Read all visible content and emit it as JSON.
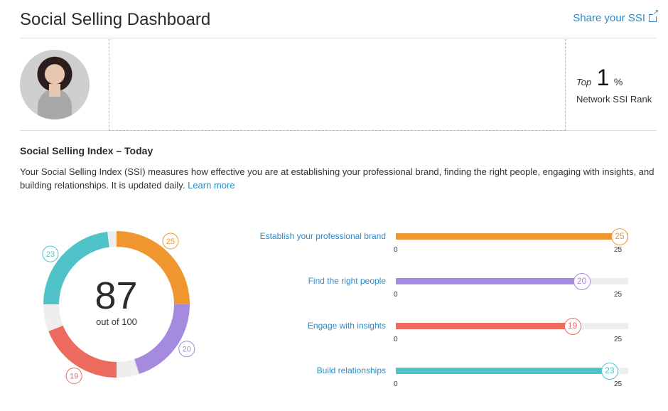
{
  "header": {
    "title": "Social Selling Dashboard",
    "share_label": "Share your SSI"
  },
  "profile": {
    "rank_top_label": "Top",
    "rank_value": "1",
    "rank_unit": "%",
    "rank_caption": "Network SSI Rank"
  },
  "ssi": {
    "title": "Social Selling Index – Today",
    "description": "Your Social Selling Index (SSI) measures how effective you are at establishing your professional brand, finding the right people, engaging with insights, and building relationships. It is updated daily.",
    "learn_more": "Learn more",
    "score": "87",
    "out_of": "out of 100"
  },
  "components": [
    {
      "label": "Establish your professional brand",
      "value": 25,
      "max": 25,
      "color": "#f0962f"
    },
    {
      "label": "Find the right people",
      "value": 20,
      "max": 25,
      "color": "#a58be0"
    },
    {
      "label": "Engage with insights",
      "value": 19,
      "max": 25,
      "color": "#ec6b5e"
    },
    {
      "label": "Build relationships",
      "value": 23,
      "max": 25,
      "color": "#4fc3c8"
    }
  ],
  "scale": {
    "min_label": "0",
    "max_label": "25"
  },
  "donut_bg_color": "#eeeeee"
}
